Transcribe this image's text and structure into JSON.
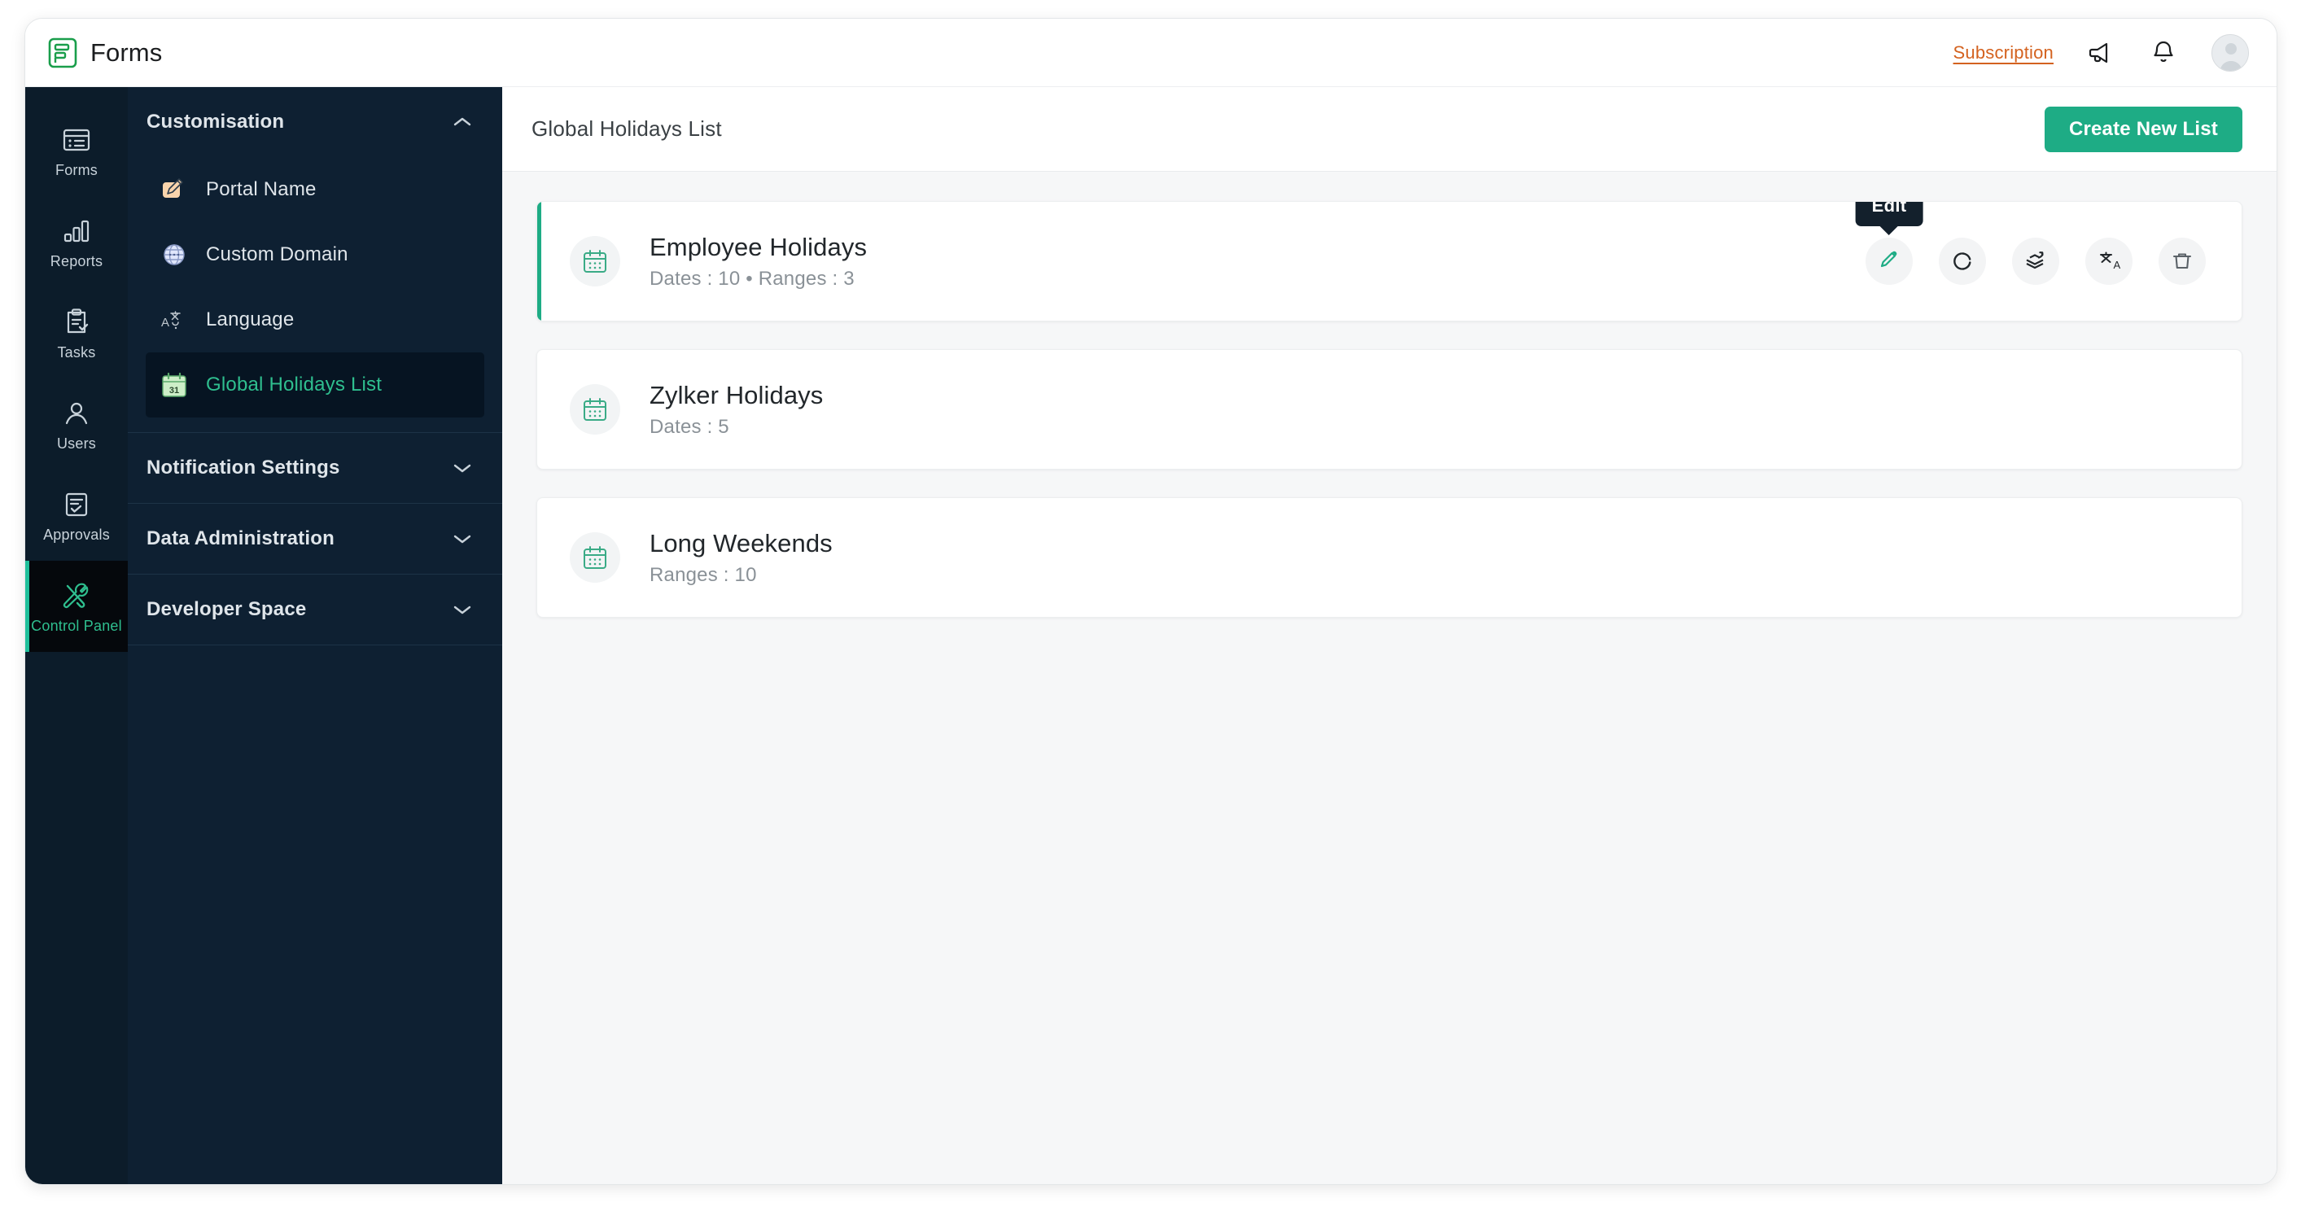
{
  "app": {
    "name": "Forms",
    "logo_icon": "forms-logo-icon"
  },
  "topbar": {
    "subscription_label": "Subscription",
    "announcement_icon": "megaphone-icon",
    "notification_icon": "bell-icon",
    "avatar_icon": "user-avatar"
  },
  "rail": {
    "items": [
      {
        "label": "Forms",
        "icon": "forms-icon",
        "active": false
      },
      {
        "label": "Reports",
        "icon": "bar-chart-icon",
        "active": false
      },
      {
        "label": "Tasks",
        "icon": "clipboard-check-icon",
        "active": false
      },
      {
        "label": "Users",
        "icon": "user-icon",
        "active": false
      },
      {
        "label": "Approvals",
        "icon": "approval-check-icon",
        "active": false
      },
      {
        "label": "Control Panel",
        "icon": "tools-icon",
        "active": true
      }
    ]
  },
  "subnav": {
    "sections": [
      {
        "title": "Customisation",
        "expanded": true,
        "chevron": "chevron-up-icon",
        "items": [
          {
            "label": "Portal Name",
            "icon": "portal-name-icon",
            "active": false
          },
          {
            "label": "Custom Domain",
            "icon": "globe-icon",
            "active": false
          },
          {
            "label": "Language",
            "icon": "translate-icon",
            "active": false
          },
          {
            "label": "Global Holidays List",
            "icon": "calendar-31-icon",
            "active": true
          }
        ]
      },
      {
        "title": "Notification Settings",
        "expanded": false,
        "chevron": "chevron-down-icon",
        "items": []
      },
      {
        "title": "Data Administration",
        "expanded": false,
        "chevron": "chevron-down-icon",
        "items": []
      },
      {
        "title": "Developer Space",
        "expanded": false,
        "chevron": "chevron-down-icon",
        "items": []
      }
    ]
  },
  "main": {
    "page_title": "Global Holidays List",
    "create_button_label": "Create New List",
    "tooltip": {
      "label": "Edit",
      "on_action": "edit"
    },
    "actions": [
      {
        "name": "edit",
        "icon": "pencil-icon",
        "accent": "#1eac85"
      },
      {
        "name": "recurring",
        "icon": "refresh-circle-icon",
        "accent": "#22272b"
      },
      {
        "name": "clone",
        "icon": "layers-arrow-icon",
        "accent": "#22272b"
      },
      {
        "name": "translate",
        "icon": "translate-icon",
        "accent": "#22272b"
      },
      {
        "name": "delete",
        "icon": "trash-icon",
        "accent": "#5b6268"
      }
    ],
    "cards": [
      {
        "title": "Employee Holidays",
        "meta": "Dates : 10   •   Ranges : 3",
        "icon": "calendar-icon",
        "selected": true,
        "show_actions": true
      },
      {
        "title": "Zylker Holidays",
        "meta": "Dates : 5",
        "icon": "calendar-icon",
        "selected": false,
        "show_actions": false
      },
      {
        "title": "Long Weekends",
        "meta": "Ranges : 10",
        "icon": "calendar-icon",
        "selected": false,
        "show_actions": false
      }
    ]
  },
  "colors": {
    "brand_green": "#1eac85",
    "rail_bg": "#0c1c2a",
    "subnav_bg": "#0e2032",
    "main_bg": "#f6f7f8",
    "subscription": "#d4621f",
    "tooltip_bg": "#13202c"
  }
}
